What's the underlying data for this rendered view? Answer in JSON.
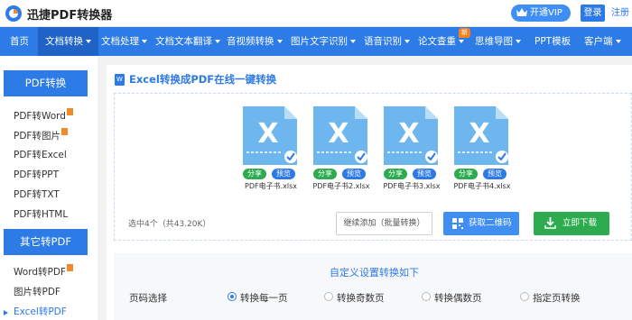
{
  "header": {
    "brand": "迅捷PDF转换器",
    "vip_label": "开通VIP",
    "login_label": "登录",
    "register_label": "注册"
  },
  "nav": {
    "badge": "新",
    "items": [
      {
        "label": "首页",
        "dropdown": false
      },
      {
        "label": "文档转换",
        "dropdown": true,
        "active": true
      },
      {
        "label": "文档处理",
        "dropdown": true
      },
      {
        "label": "文档文本翻译",
        "dropdown": true
      },
      {
        "label": "音视频转换",
        "dropdown": true
      },
      {
        "label": "图片文字识别",
        "dropdown": true
      },
      {
        "label": "语音识别",
        "dropdown": true
      },
      {
        "label": "论文查重",
        "dropdown": true
      },
      {
        "label": "思维导图",
        "dropdown": true
      },
      {
        "label": "PPT模板",
        "dropdown": false
      },
      {
        "label": "客户端",
        "dropdown": true
      }
    ]
  },
  "sidebar": {
    "pdf_section": "PDF转换",
    "pdf_items": [
      {
        "label": "PDF转Word",
        "hot": true
      },
      {
        "label": "PDF转图片",
        "hot": true
      },
      {
        "label": "PDF转Excel"
      },
      {
        "label": "PDF转PPT"
      },
      {
        "label": "PDF转TXT"
      },
      {
        "label": "PDF转HTML"
      }
    ],
    "other_section": "其它转PDF",
    "other_items": [
      {
        "label": "Word转PDF",
        "hot": true
      },
      {
        "label": "图片转PDF"
      },
      {
        "label": "Excel转PDF",
        "active": true
      }
    ]
  },
  "main": {
    "title_icon": "W",
    "title": "Excel转换成PDF在线一键转换",
    "files": [
      {
        "name": "PDF电子书.xlsx",
        "icon_letter": "X"
      },
      {
        "name": "PDF电子书2.xlsx",
        "icon_letter": "X"
      },
      {
        "name": "PDF电子书3.xlsx",
        "icon_letter": "X"
      },
      {
        "name": "PDF电子书4.xlsx",
        "icon_letter": "X"
      }
    ],
    "share_label": "分享",
    "preview_label": "预览",
    "selected_info": "选中4个（共43.20K）",
    "continue_label": "继续添加（批量转换）",
    "qr_label": "获取二维码",
    "download_label": "立即下载"
  },
  "settings": {
    "title": "自定义设置转换如下",
    "page_label": "页码选择",
    "options": [
      "转换每一页",
      "转换奇数页",
      "转换偶数页",
      "指定页转换"
    ]
  },
  "colors": {
    "primary": "#2d7be6",
    "nav_active": "#1f63c6",
    "green": "#2dab4f",
    "file_icon": "#6db6ee",
    "hot": "#f08a2a"
  }
}
